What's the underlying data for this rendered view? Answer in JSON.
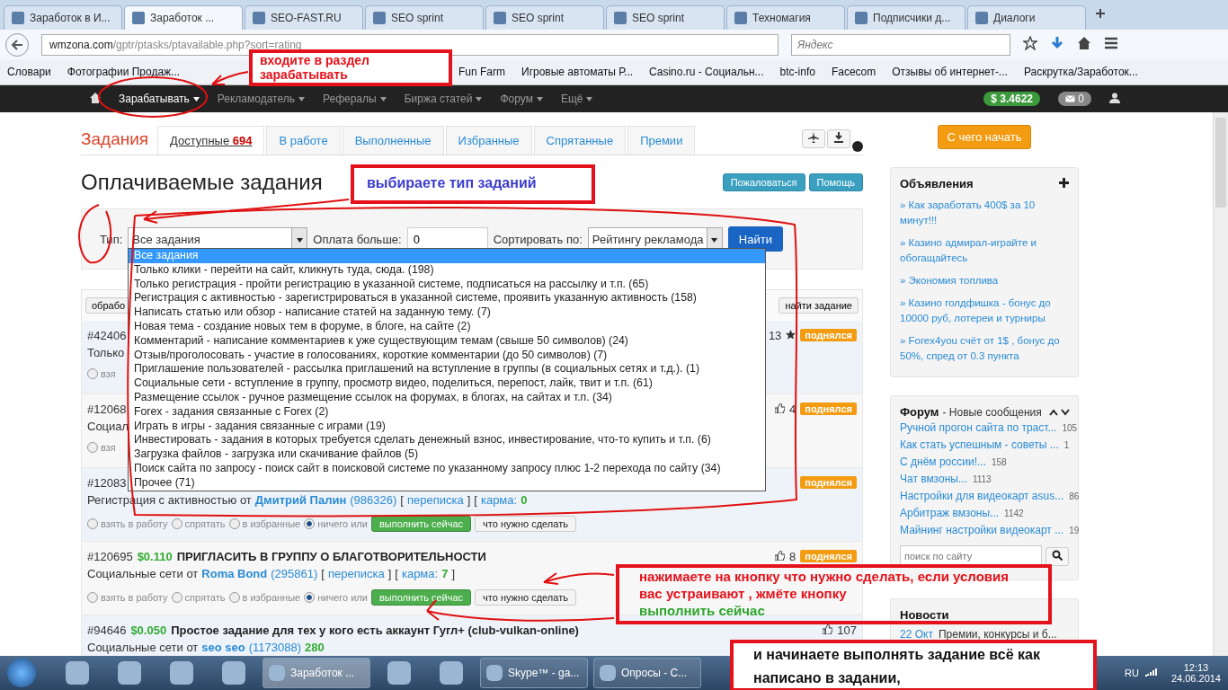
{
  "browser": {
    "tabs": [
      {
        "title": "Заработок в И...",
        "selected": false
      },
      {
        "title": "Заработок ...",
        "selected": true
      },
      {
        "title": "SEO-FAST.RU",
        "selected": false
      },
      {
        "title": "SEO sprint",
        "selected": false
      },
      {
        "title": "SEO sprint",
        "selected": false
      },
      {
        "title": "SEO sprint",
        "selected": false
      },
      {
        "title": "Техномагия",
        "selected": false
      },
      {
        "title": "Подписчики д...",
        "selected": false
      },
      {
        "title": "Диалоги",
        "selected": false
      }
    ],
    "url_host": "wmzona.com",
    "url_path": "/gptr/ptasks/ptavailable.php?sort=rating",
    "search_placeholder": "Яндекс",
    "bookmarks_left": [
      "Словари",
      "Фотографии Продаж..."
    ],
    "bookmarks_right": [
      "Fun Farm",
      "Игровые автоматы Р...",
      "Casino.ru - Социальн...",
      "btc-info",
      "Facecom",
      "Отзывы об интернет-...",
      "Раскрутка/Заработок..."
    ]
  },
  "site_nav": {
    "items": [
      {
        "label": "Зарабатывать",
        "selected": true
      },
      {
        "label": "Рекламодатель",
        "selected": false
      },
      {
        "label": "Рефералы",
        "selected": false
      },
      {
        "label": "Биржа статей",
        "selected": false
      },
      {
        "label": "Форум",
        "selected": false
      },
      {
        "label": "Ещё",
        "selected": false
      }
    ],
    "balance": "$ 3.4622",
    "messages": "0"
  },
  "tasks": {
    "heading": "Задания",
    "tabs": [
      {
        "label": "Доступные",
        "count": "694",
        "selected": true
      },
      {
        "label": "В работе",
        "selected": false
      },
      {
        "label": "Выполненные",
        "selected": false
      },
      {
        "label": "Избранные",
        "selected": false
      },
      {
        "label": "Спрятанные",
        "selected": false
      },
      {
        "label": "Премии",
        "selected": false
      }
    ],
    "page_title": "Оплачиваемые задания",
    "buttons": [
      "Пожаловаться",
      "Помощь"
    ]
  },
  "filter": {
    "type_label": "Тип:",
    "type_value": "Все задания",
    "pay_label": "Оплата больше:",
    "pay_value": "0",
    "sort_label": "Сортировать по:",
    "sort_value": "Рейтингу рекламода",
    "submit": "Найти"
  },
  "dropdown": [
    {
      "label": "Все задания",
      "selected": true
    },
    {
      "label": "Только клики - перейти на сайт, кликнуть туда, сюда. (198)",
      "selected": false
    },
    {
      "label": "Только регистрация - пройти регистрацию в указанной системе, подписаться на рассылку и т.п. (65)",
      "selected": false
    },
    {
      "label": "Регистрация с активностью - зарегистрироваться в указанной системе, проявить указанную активность (158)",
      "selected": false
    },
    {
      "label": "Написать статью или обзор - написание статей на заданную тему. (7)",
      "selected": false
    },
    {
      "label": "Новая тема - создание новых тем в форуме, в блоге, на сайте (2)",
      "selected": false
    },
    {
      "label": "Комментарий - написание комментариев к уже существующим темам (свыше 50 символов) (24)",
      "selected": false
    },
    {
      "label": "Отзыв/проголосовать - участие в голосованиях, короткие комментарии (до 50 символов) (7)",
      "selected": false
    },
    {
      "label": "Приглашение пользователей - рассылка приглашений на вступление в группы (в социальных сетях и т.д.). (1)",
      "selected": false
    },
    {
      "label": "Социальные сети - вступление в группу, просмотр видео, поделиться, перепост, лайк, твит и т.п. (61)",
      "selected": false
    },
    {
      "label": "Размещение ссылок - ручное размещение ссылок на форумах, в блогах, на сайтах и т.п. (34)",
      "selected": false
    },
    {
      "label": "Forex - задания связанные с Forex (2)",
      "selected": false
    },
    {
      "label": "Играть в игры - задания связанные с играми (19)",
      "selected": false
    },
    {
      "label": "Инвестировать - задания в которых требуется сделать денежный взнос, инвестирование, что-то купить и т.п. (6)",
      "selected": false
    },
    {
      "label": "Загрузка файлов - загрузка или скачивание файлов (5)",
      "selected": false
    },
    {
      "label": "Поиск сайта по запросу - поиск сайт в поисковой системе по указанному запросу плюс 1-2 перехода по сайту (34)",
      "selected": false
    },
    {
      "label": "Прочее (71)",
      "selected": false
    }
  ],
  "toolbar": {
    "left": "обрабо",
    "right": "найти задание"
  },
  "rows": [
    {
      "id": "#42406",
      "meta": [
        {
          "kind": "plain",
          "text": "Только"
        }
      ],
      "rating": "13",
      "badge": "поднялся",
      "radios": [
        {
          "label": "взя",
          "selected": false
        }
      ]
    },
    {
      "id": "#12068",
      "meta": [
        {
          "kind": "plain",
          "text": "Социал"
        }
      ],
      "likes": "4",
      "badge": "поднялся",
      "radios": [
        {
          "label": "взя",
          "selected": false
        }
      ]
    },
    {
      "id": "#12083",
      "meta": [
        {
          "kind": "plain",
          "text": "Регистрация с активностью от"
        },
        {
          "kind": "author",
          "text": "Дмитрий Палин"
        },
        {
          "kind": "link",
          "text": "(986326)"
        },
        {
          "kind": "plain",
          "text": "["
        },
        {
          "kind": "link",
          "text": "переписка"
        },
        {
          "kind": "plain",
          "text": "]"
        },
        {
          "kind": "plain",
          "text": "["
        },
        {
          "kind": "link",
          "text": "карма:"
        },
        {
          "kind": "green",
          "text": "0"
        }
      ],
      "badge": "поднялся",
      "radios": [
        {
          "label": "взять в работу",
          "selected": false
        },
        {
          "label": "спрятать",
          "selected": false
        },
        {
          "label": "в избранные",
          "selected": false
        },
        {
          "label": "ничего или",
          "selected": true
        }
      ],
      "buttons": [
        "выполнить сейчас",
        "что нужно сделать"
      ]
    },
    {
      "id": "#120695",
      "price": "$0.110",
      "title": "ПРИГЛАСИТЬ В ГРУППУ О БЛАГОТВОРИТЕЛЬНОСТИ",
      "meta": [
        {
          "kind": "plain",
          "text": "Социальные сети от"
        },
        {
          "kind": "author",
          "text": "Roma Bond"
        },
        {
          "kind": "link",
          "text": "(295861)"
        },
        {
          "kind": "plain",
          "text": "["
        },
        {
          "kind": "link",
          "text": "переписка"
        },
        {
          "kind": "plain",
          "text": "]"
        },
        {
          "kind": "plain",
          "text": "["
        },
        {
          "kind": "link",
          "text": "карма:"
        },
        {
          "kind": "green",
          "text": "7"
        },
        {
          "kind": "plain",
          "text": "]"
        }
      ],
      "likes": "8",
      "badge": "поднялся",
      "radios": [
        {
          "label": "взять в работу",
          "selected": false
        },
        {
          "label": "спрятать",
          "selected": false
        },
        {
          "label": "в избранные",
          "selected": false
        },
        {
          "label": "ничего или",
          "selected": true
        }
      ],
      "buttons": [
        "выполнить сейчас",
        "что нужно сделать"
      ]
    },
    {
      "id": "#94646",
      "price": "$0.050",
      "title": "Простое задание для тех у кого есть аккаунт Гугл+ (club-vulkan-online)",
      "meta": [
        {
          "kind": "plain",
          "text": "Социальные сети от"
        },
        {
          "kind": "author",
          "text": "seo seo"
        },
        {
          "kind": "link",
          "text": "(1173088)"
        },
        {
          "kind": "green",
          "text": "280"
        }
      ],
      "likes": "107"
    }
  ],
  "sidebar": {
    "start_button": "С чего начать",
    "ads": {
      "title": "Объявления",
      "items": [
        "» Как заработать 400$ за 10 минут!!!",
        "» Казино адмирал-играйте и обогащайтесь",
        "» Экономия топлива",
        "» Казино голдфишка - бонус до 10000 руб, лотереи и турниры",
        "» Forex4you счёт от 1$ , бонус до 50%, спред от 0.3 пункта"
      ]
    },
    "forum": {
      "title": "Форум",
      "subtitle": "- Новые сообщения",
      "items": [
        {
          "title": "Ручной прогон сайта по траст...",
          "count": "105"
        },
        {
          "title": "Как стать успешным - советы ...",
          "count": "1"
        },
        {
          "title": "С днём россии!...",
          "count": "158"
        },
        {
          "title": "Чат вмзоны...",
          "count": "1113"
        },
        {
          "title": "Настройки для видеокарт asus...",
          "count": "86"
        },
        {
          "title": "Арбитраж вмзоны...",
          "count": "1142"
        },
        {
          "title": "Майнинг настройки видеокарт ...",
          "count": "19"
        }
      ],
      "search_placeholder": "поиск по сайту"
    },
    "news": {
      "title": "Новости",
      "items": [
        {
          "date": "22 Окт",
          "text": "Премии, конкурсы и б..."
        }
      ]
    }
  },
  "annotations": [
    {
      "kind": "red",
      "parts": [
        {
          "text": "входите в раздел зарабатывать",
          "kind": "red"
        }
      ]
    },
    {
      "kind": "blue",
      "parts": [
        {
          "text": "выбираете тип заданий",
          "kind": "blue"
        }
      ]
    },
    {
      "kind": "big",
      "parts": [
        {
          "text": "нажимаете на кнопку что нужно сделать, если условия вас устраивают , жмёте кнопку",
          "kind": "red"
        },
        {
          "text": "выполнить сейчас",
          "kind": "green"
        }
      ]
    },
    {
      "kind": "bottom",
      "parts": [
        {
          "text": "и начинаете выполнять задание всё как написано в задании,",
          "kind": "black"
        }
      ]
    }
  ],
  "taskbar": {
    "items": [
      {
        "kind": "icon"
      },
      {
        "kind": "icon"
      },
      {
        "kind": "icon"
      },
      {
        "kind": "icon"
      },
      {
        "kind": "task",
        "label": "Заработок ...",
        "selected": true
      },
      {
        "kind": "icon"
      },
      {
        "kind": "icon"
      },
      {
        "kind": "task",
        "label": "Skype™ - ga...",
        "selected": false
      },
      {
        "kind": "task",
        "label": "Опросы - С...",
        "selected": false
      }
    ],
    "lang": "RU",
    "time": "12:13",
    "date": "24.06.2014"
  }
}
